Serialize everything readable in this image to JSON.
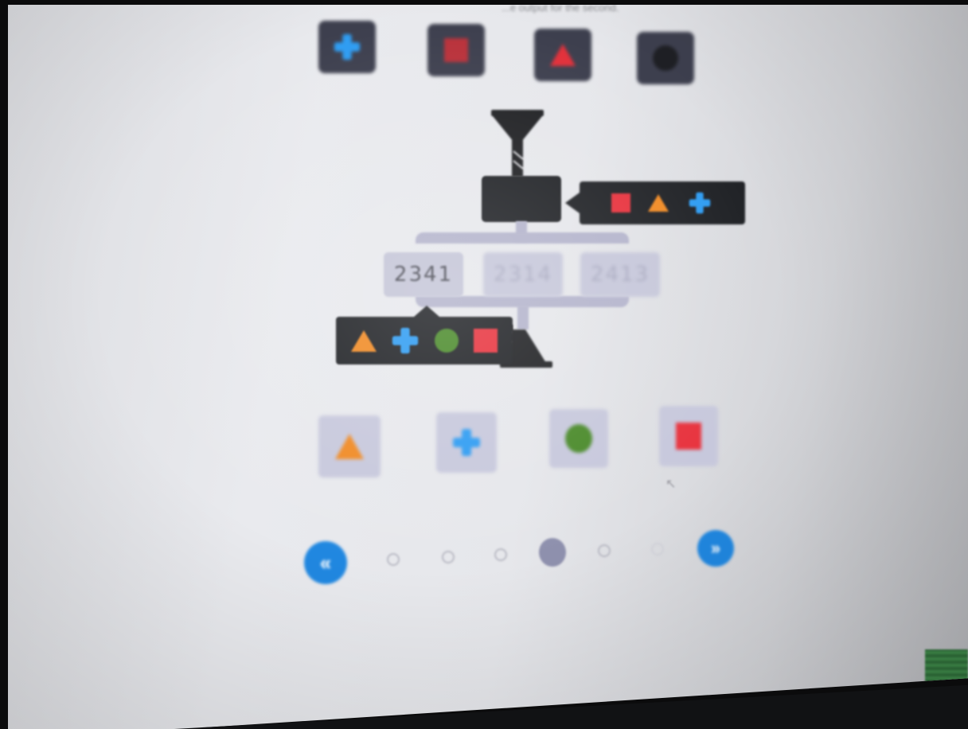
{
  "header": {
    "instruction_fragment": "...e output for the second."
  },
  "code_tiles": [
    {
      "shape": "plus",
      "name": "plus-icon"
    },
    {
      "shape": "square",
      "name": "square-icon"
    },
    {
      "shape": "triangle",
      "name": "triangle-icon"
    },
    {
      "shape": "circle",
      "name": "circle-icon"
    }
  ],
  "machine": {
    "hint_sequence": [
      "square",
      "triangle",
      "plus"
    ],
    "options": [
      {
        "label": "2341",
        "faded": false
      },
      {
        "label": "2314",
        "faded": true
      },
      {
        "label": "2413",
        "faded": true
      }
    ],
    "result_sequence": [
      "triangle",
      "plus",
      "circle",
      "square"
    ]
  },
  "answer_tiles": [
    {
      "shape": "triangle",
      "name": "triangle-icon"
    },
    {
      "shape": "plus",
      "name": "plus-icon"
    },
    {
      "shape": "circle",
      "name": "circle-icon"
    },
    {
      "shape": "square",
      "name": "square-icon"
    }
  ],
  "pagination": {
    "prev_icon": "«",
    "next_icon": "»",
    "dot_count": 6,
    "active_index": 3
  },
  "colors": {
    "triangle": "#f08a24",
    "plus": "#2e9cf2",
    "circle": "#4a8a2a",
    "square": "#e8333e",
    "dark_panel": "#202226",
    "tile": "#c7c8dc",
    "nav_blue": "#2087e0"
  }
}
